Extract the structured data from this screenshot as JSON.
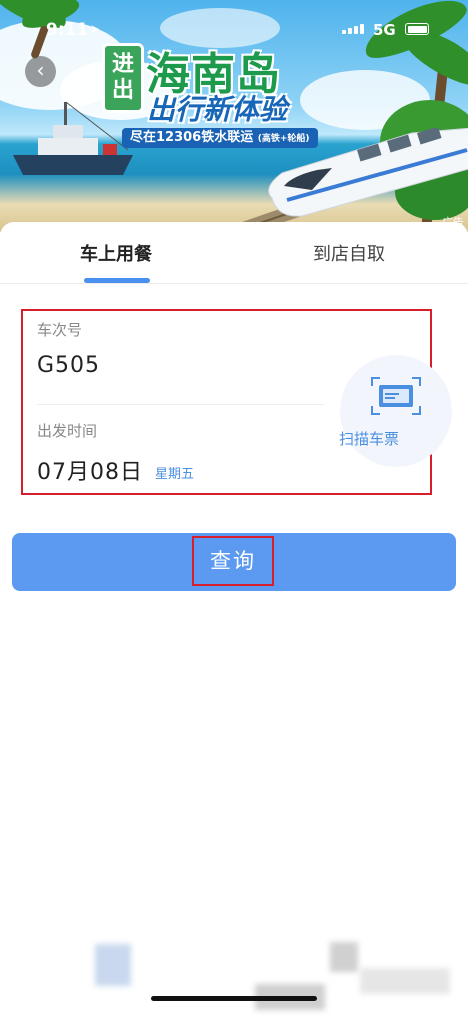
{
  "status_bar": {
    "time": "9:11",
    "network": "5G"
  },
  "banner": {
    "logo_line1": "进",
    "logo_line2": "出",
    "title_main": "海南岛",
    "title_sub": "出行新体验",
    "slogan": "尽在12306铁水联运",
    "slogan_note": "(高铁+轮船)",
    "ad_tag": "广告"
  },
  "tabs": [
    {
      "label": "车上用餐",
      "active": true
    },
    {
      "label": "到店自取",
      "active": false
    }
  ],
  "form": {
    "train_no_label": "车次号",
    "train_no_value": "G505",
    "depart_label": "出发时间",
    "depart_date": "07月08日",
    "depart_weekday": "星期五",
    "scan_label": "扫描车票"
  },
  "query_button": "查询",
  "colors": {
    "accent": "#5b9af0",
    "highlight_border": "#d81e2c",
    "link_blue": "#4a8fe0"
  }
}
